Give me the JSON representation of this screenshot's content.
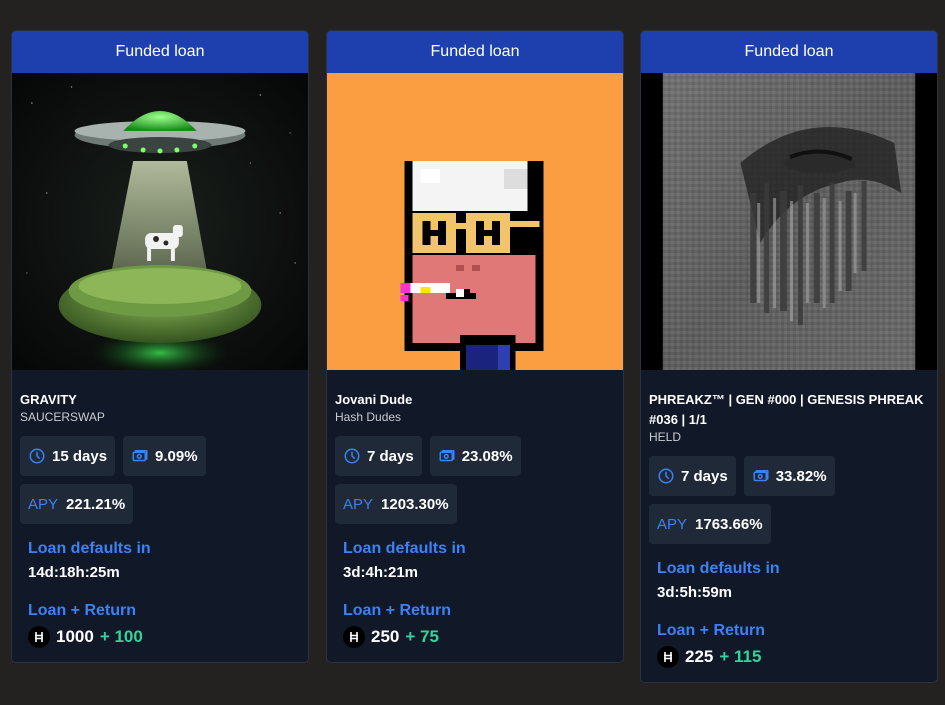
{
  "cards": [
    {
      "header": "Funded loan",
      "image_icon": "ufo-abducting-cow-artwork",
      "name": "GRAVITY",
      "collection": "SAUCERSWAP",
      "duration": "15 days",
      "interest_rate": "9.09%",
      "apy_label": "APY",
      "apy": "221.21%",
      "defaults_label": "Loan defaults in",
      "defaults_in": "14d:18h:25m",
      "return_label": "Loan + Return",
      "principal": "1000",
      "interest": "+ 100"
    },
    {
      "header": "Funded loan",
      "image_icon": "pixel-dude-artwork",
      "name": "Jovani Dude",
      "collection": "Hash Dudes",
      "duration": "7 days",
      "interest_rate": "23.08%",
      "apy_label": "APY",
      "apy": "1203.30%",
      "defaults_label": "Loan defaults in",
      "defaults_in": "3d:4h:21m",
      "return_label": "Loan + Return",
      "principal": "250",
      "interest": "+ 75"
    },
    {
      "header": "Funded loan",
      "image_icon": "abstract-face-artwork",
      "name": "PHREAKZ™ | GEN #000 | GENESIS PHREAK #036 | 1/1",
      "collection": "HELD",
      "duration": "7 days",
      "interest_rate": "33.82%",
      "apy_label": "APY",
      "apy": "1763.66%",
      "defaults_label": "Loan defaults in",
      "defaults_in": "3d:5h:59m",
      "return_label": "Loan + Return",
      "principal": "225",
      "interest": "+ 115"
    }
  ],
  "colors": {
    "header_bg": "#1e40af",
    "card_bg": "#111827",
    "chip_bg": "#1f2937",
    "accent_blue": "#3b82f6",
    "interest_green": "#34d399"
  },
  "icons": {
    "duration": "clock-icon",
    "rate": "cash-icon",
    "currency": "hbar-icon"
  }
}
